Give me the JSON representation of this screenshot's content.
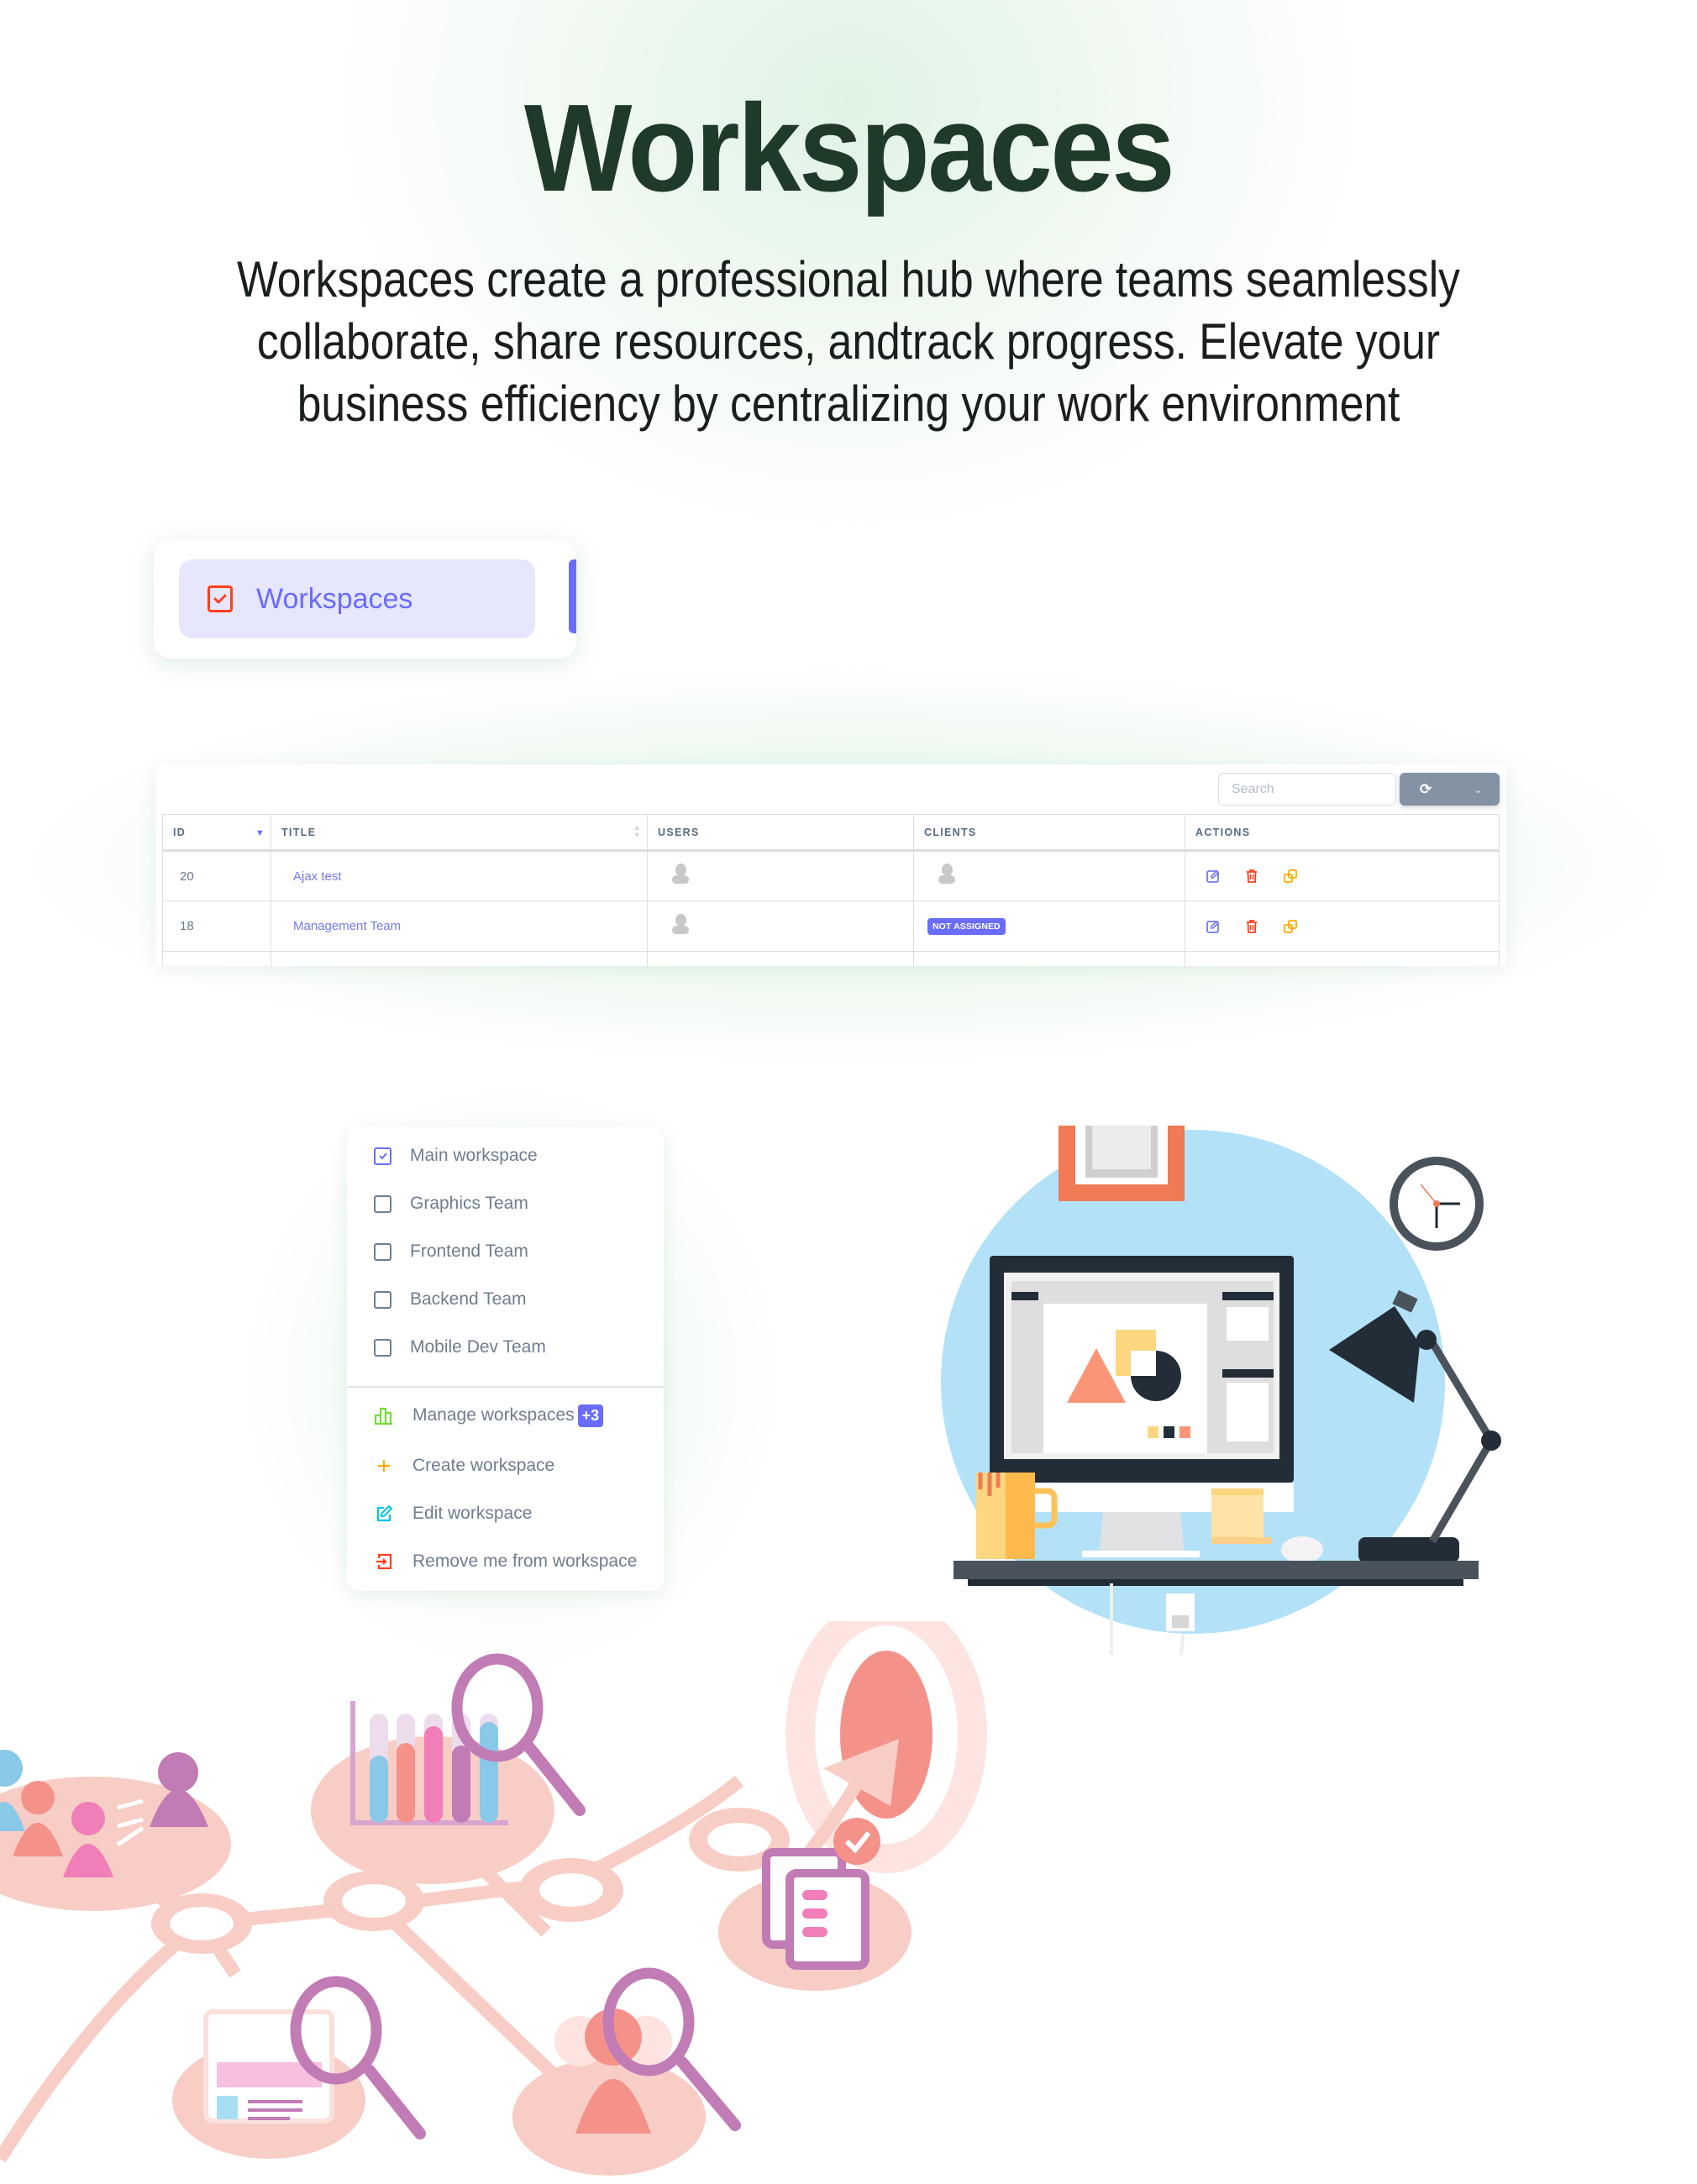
{
  "hero": {
    "title": "Workspaces",
    "subtitle_lines": [
      "Workspaces create a professional hub where teams seamlessly",
      "collaborate, share resources, andtrack progress. Elevate your",
      "business efficiency by centralizing your work environment"
    ]
  },
  "sidebar": {
    "active_item": {
      "label": "Workspaces",
      "icon": "checkbox-icon"
    }
  },
  "table": {
    "search_placeholder": "Search",
    "refresh_icon": "refresh-icon",
    "dropdown_icon": "chevron-down-icon",
    "columns": [
      "ID",
      "TITLE",
      "USERS",
      "CLIENTS",
      "ACTIONS"
    ],
    "rows": [
      {
        "id": "20",
        "title": "Ajax test",
        "users": "avatar",
        "clients": "avatar",
        "actions": [
          "edit",
          "delete",
          "duplicate"
        ]
      },
      {
        "id": "18",
        "title": "Management Team",
        "users": "avatar",
        "clients": "NOT ASSIGNED",
        "actions": [
          "edit",
          "delete",
          "duplicate"
        ]
      }
    ]
  },
  "menu": {
    "workspaces": [
      {
        "label": "Main workspace",
        "checked": true
      },
      {
        "label": "Graphics Team",
        "checked": false
      },
      {
        "label": "Frontend Team",
        "checked": false
      },
      {
        "label": "Backend Team",
        "checked": false
      },
      {
        "label": "Mobile Dev Team",
        "checked": false
      }
    ],
    "actions": [
      {
        "label": "Manage workspaces",
        "icon": "bar-chart-icon",
        "badge": "+3",
        "color": "#71dd37"
      },
      {
        "label": "Create workspace",
        "icon": "plus-icon",
        "color": "#ffab00"
      },
      {
        "label": "Edit workspace",
        "icon": "edit-icon",
        "color": "#03c3ec"
      },
      {
        "label": "Remove me from workspace",
        "icon": "logout-icon",
        "color": "#ff3e1d"
      }
    ]
  },
  "colors": {
    "primary": "#696cff",
    "danger": "#ff3e1d",
    "warning": "#ffab00",
    "secondary": "#8592a3",
    "title": "#203a29"
  }
}
